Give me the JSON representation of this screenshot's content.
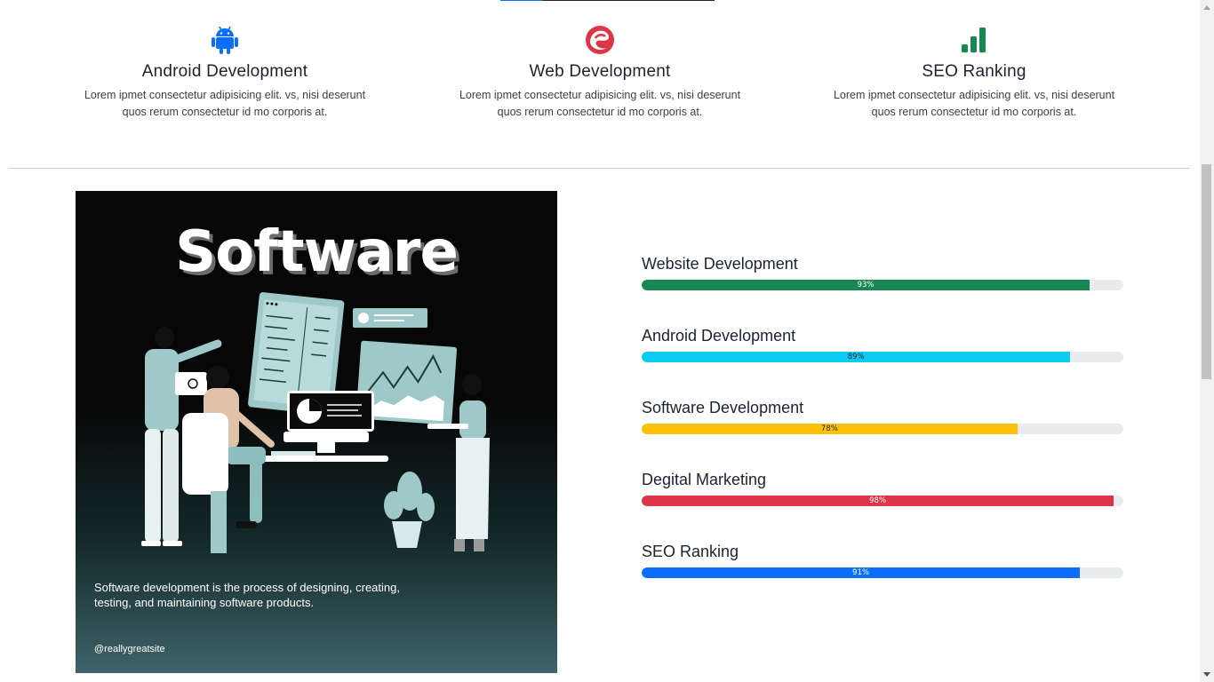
{
  "services": [
    {
      "title": "Android Development",
      "description": "Lorem ipmet consectetur adipisicing elit. vs, nisi deserunt quos rerum consectetur id mo corporis at.",
      "icon": "android-icon"
    },
    {
      "title": "Web Development",
      "description": "Lorem ipmet consectetur adipisicing elit. vs, nisi deserunt quos rerum consectetur id mo corporis at.",
      "icon": "edge-icon"
    },
    {
      "title": "SEO Ranking",
      "description": "Lorem ipmet consectetur adipisicing elit. vs, nisi deserunt quos rerum consectetur id mo corporis at.",
      "icon": "bar-chart-icon"
    }
  ],
  "poster": {
    "title": "Software",
    "description": "Software development is the process of designing, creating, testing, and maintaining software products.",
    "handle": "@reallygreatsite"
  },
  "skills": [
    {
      "label": "Website Development",
      "value": 93,
      "value_text": "93%",
      "color": "#198754",
      "text_color": "#ffffff"
    },
    {
      "label": "Android Development",
      "value": 89,
      "value_text": "89%",
      "color": "#0dcaf0",
      "text_color": "#212529"
    },
    {
      "label": "Software Development",
      "value": 78,
      "value_text": "78%",
      "color": "#ffc107",
      "text_color": "#212529"
    },
    {
      "label": "Degital Marketing",
      "value": 98,
      "value_text": "98%",
      "color": "#dc3545",
      "text_color": "#ffffff"
    },
    {
      "label": "SEO Ranking",
      "value": 91,
      "value_text": "91%",
      "color": "#0d6efd",
      "text_color": "#ffffff"
    }
  ],
  "colors": {
    "android": "#0d6efd",
    "web": "#dc3545",
    "seo": "#198754"
  }
}
